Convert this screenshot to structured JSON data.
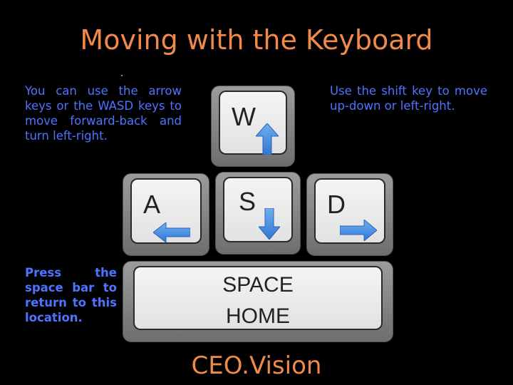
{
  "title": "Moving with the Keyboard",
  "notes": {
    "arrows": "You can use the arrow keys or the WASD keys to move forward-back and turn left-right.",
    "shift": "Use the shift key to move up-down or left-right.",
    "space": "Press the space bar to return to this location."
  },
  "keys": {
    "w": "W",
    "a": "A",
    "s": "S",
    "d": "D",
    "space_line1": "SPACE",
    "space_line2": "HOME"
  },
  "footer": "CEO.Vision",
  "colors": {
    "title": "#f08a4b",
    "note_text": "#4e73ff",
    "arrow": "#4a8fe0",
    "background": "#000000"
  },
  "icons": {
    "w": "arrow-up-icon",
    "a": "arrow-left-icon",
    "s": "arrow-down-icon",
    "d": "arrow-right-icon"
  }
}
